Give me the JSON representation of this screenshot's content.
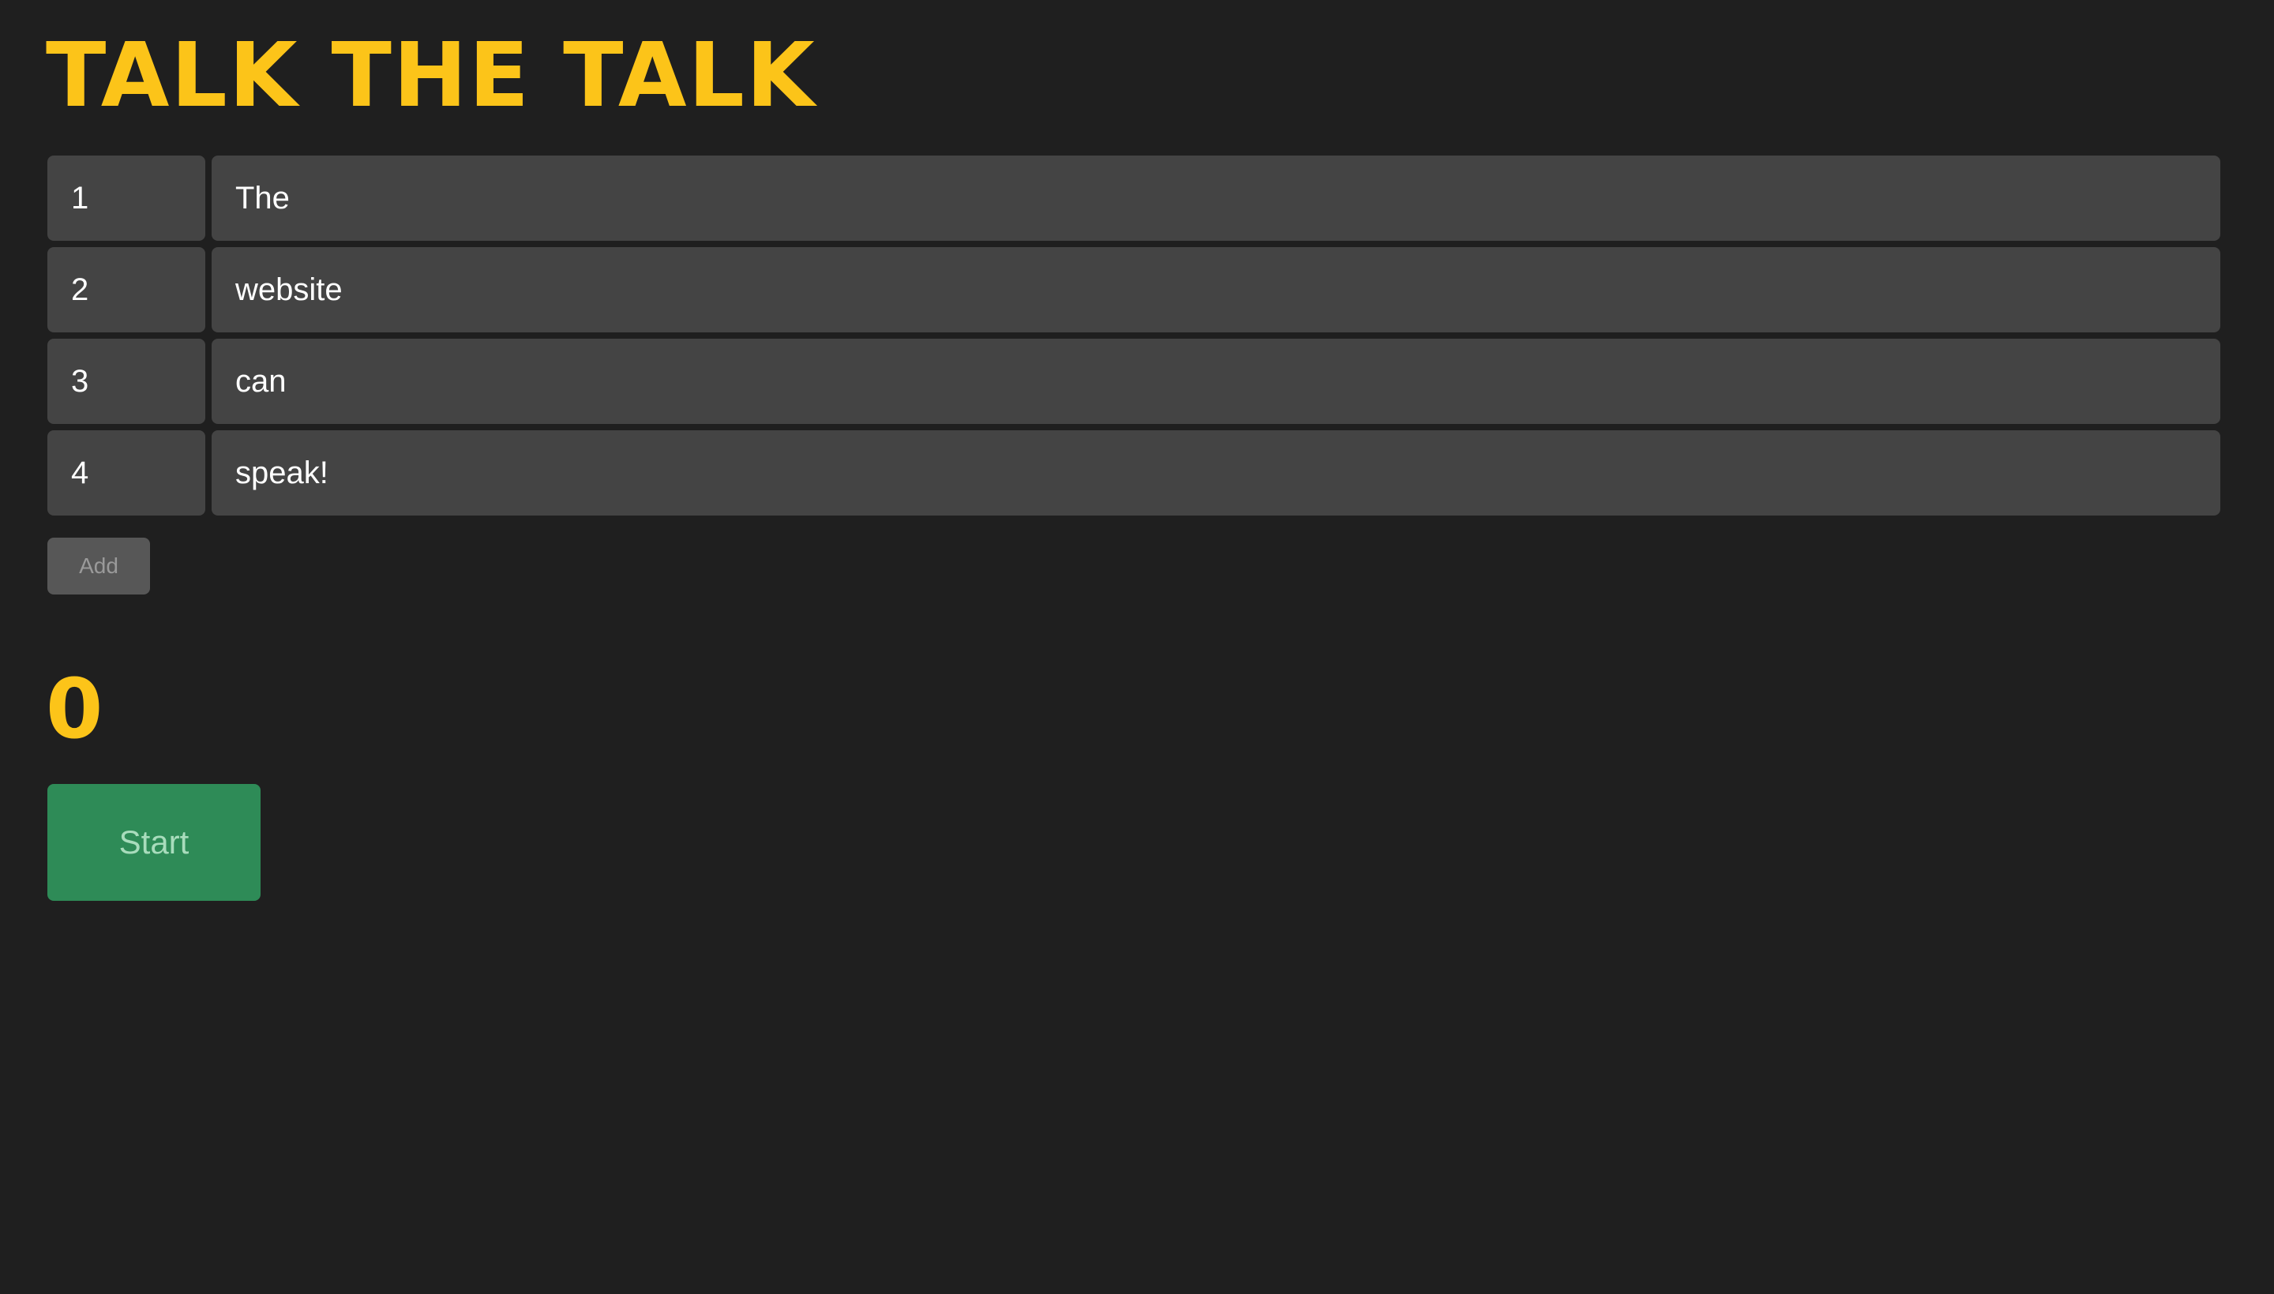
{
  "header": {
    "title": "Talk the Talk"
  },
  "words": [
    {
      "index": "1",
      "word": "The"
    },
    {
      "index": "2",
      "word": "website"
    },
    {
      "index": "3",
      "word": "can"
    },
    {
      "index": "4",
      "word": "speak!"
    }
  ],
  "controls": {
    "add_label": "Add",
    "counter": "0",
    "start_label": "Start"
  },
  "colors": {
    "background": "#1f1f1f",
    "accent": "#fcc419",
    "field": "#444444",
    "start": "#2e8b57"
  }
}
